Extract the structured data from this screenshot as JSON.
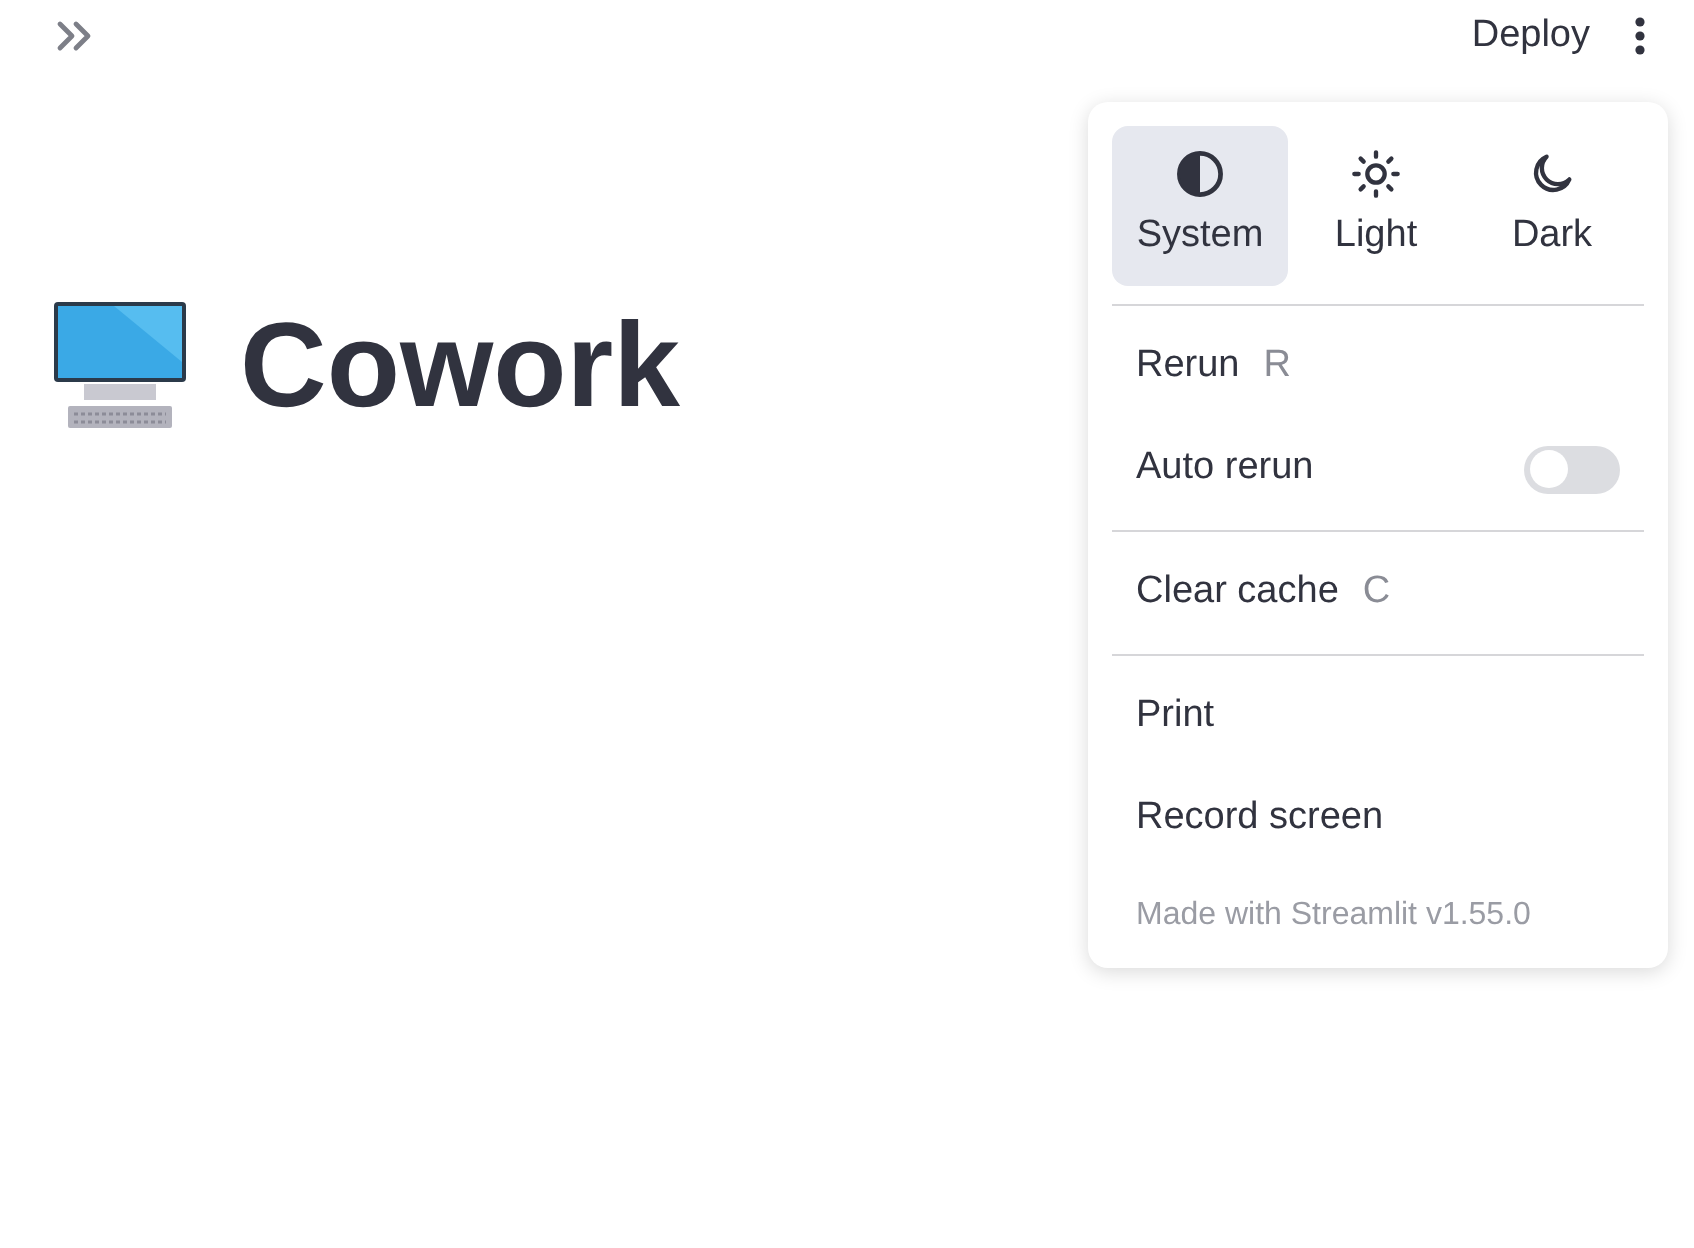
{
  "header": {
    "deploy": "Deploy"
  },
  "title": "Cowork",
  "menu": {
    "themes": [
      {
        "kind": "system",
        "label": "System",
        "selected": true
      },
      {
        "kind": "light",
        "label": "Light",
        "selected": false
      },
      {
        "kind": "dark",
        "label": "Dark",
        "selected": false
      }
    ],
    "groups": [
      [
        {
          "kind": "command",
          "label": "Rerun",
          "shortcut": "R"
        },
        {
          "kind": "toggle",
          "label": "Auto rerun",
          "on": false
        }
      ],
      [
        {
          "kind": "command",
          "label": "Clear cache",
          "shortcut": "C"
        }
      ],
      [
        {
          "kind": "command",
          "label": "Print"
        },
        {
          "kind": "command",
          "label": "Record screen"
        }
      ]
    ],
    "footer": "Made with Streamlit v1.55.0"
  }
}
